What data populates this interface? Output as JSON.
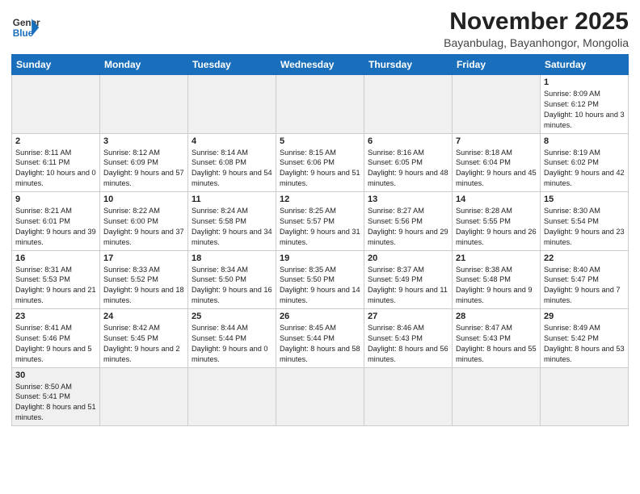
{
  "logo": {
    "general": "General",
    "blue": "Blue"
  },
  "title": "November 2025",
  "subtitle": "Bayanbulag, Bayanhongor, Mongolia",
  "days_header": [
    "Sunday",
    "Monday",
    "Tuesday",
    "Wednesday",
    "Thursday",
    "Friday",
    "Saturday"
  ],
  "weeks": [
    [
      {
        "day": "",
        "info": "",
        "empty": true
      },
      {
        "day": "",
        "info": "",
        "empty": true
      },
      {
        "day": "",
        "info": "",
        "empty": true
      },
      {
        "day": "",
        "info": "",
        "empty": true
      },
      {
        "day": "",
        "info": "",
        "empty": true
      },
      {
        "day": "",
        "info": "",
        "empty": true
      },
      {
        "day": "1",
        "info": "Sunrise: 8:09 AM\nSunset: 6:12 PM\nDaylight: 10 hours\nand 3 minutes."
      }
    ],
    [
      {
        "day": "2",
        "info": "Sunrise: 8:11 AM\nSunset: 6:11 PM\nDaylight: 10 hours\nand 0 minutes."
      },
      {
        "day": "3",
        "info": "Sunrise: 8:12 AM\nSunset: 6:09 PM\nDaylight: 9 hours\nand 57 minutes."
      },
      {
        "day": "4",
        "info": "Sunrise: 8:14 AM\nSunset: 6:08 PM\nDaylight: 9 hours\nand 54 minutes."
      },
      {
        "day": "5",
        "info": "Sunrise: 8:15 AM\nSunset: 6:06 PM\nDaylight: 9 hours\nand 51 minutes."
      },
      {
        "day": "6",
        "info": "Sunrise: 8:16 AM\nSunset: 6:05 PM\nDaylight: 9 hours\nand 48 minutes."
      },
      {
        "day": "7",
        "info": "Sunrise: 8:18 AM\nSunset: 6:04 PM\nDaylight: 9 hours\nand 45 minutes."
      },
      {
        "day": "8",
        "info": "Sunrise: 8:19 AM\nSunset: 6:02 PM\nDaylight: 9 hours\nand 42 minutes."
      }
    ],
    [
      {
        "day": "9",
        "info": "Sunrise: 8:21 AM\nSunset: 6:01 PM\nDaylight: 9 hours\nand 39 minutes."
      },
      {
        "day": "10",
        "info": "Sunrise: 8:22 AM\nSunset: 6:00 PM\nDaylight: 9 hours\nand 37 minutes."
      },
      {
        "day": "11",
        "info": "Sunrise: 8:24 AM\nSunset: 5:58 PM\nDaylight: 9 hours\nand 34 minutes."
      },
      {
        "day": "12",
        "info": "Sunrise: 8:25 AM\nSunset: 5:57 PM\nDaylight: 9 hours\nand 31 minutes."
      },
      {
        "day": "13",
        "info": "Sunrise: 8:27 AM\nSunset: 5:56 PM\nDaylight: 9 hours\nand 29 minutes."
      },
      {
        "day": "14",
        "info": "Sunrise: 8:28 AM\nSunset: 5:55 PM\nDaylight: 9 hours\nand 26 minutes."
      },
      {
        "day": "15",
        "info": "Sunrise: 8:30 AM\nSunset: 5:54 PM\nDaylight: 9 hours\nand 23 minutes."
      }
    ],
    [
      {
        "day": "16",
        "info": "Sunrise: 8:31 AM\nSunset: 5:53 PM\nDaylight: 9 hours\nand 21 minutes."
      },
      {
        "day": "17",
        "info": "Sunrise: 8:33 AM\nSunset: 5:52 PM\nDaylight: 9 hours\nand 18 minutes."
      },
      {
        "day": "18",
        "info": "Sunrise: 8:34 AM\nSunset: 5:50 PM\nDaylight: 9 hours\nand 16 minutes."
      },
      {
        "day": "19",
        "info": "Sunrise: 8:35 AM\nSunset: 5:50 PM\nDaylight: 9 hours\nand 14 minutes."
      },
      {
        "day": "20",
        "info": "Sunrise: 8:37 AM\nSunset: 5:49 PM\nDaylight: 9 hours\nand 11 minutes."
      },
      {
        "day": "21",
        "info": "Sunrise: 8:38 AM\nSunset: 5:48 PM\nDaylight: 9 hours\nand 9 minutes."
      },
      {
        "day": "22",
        "info": "Sunrise: 8:40 AM\nSunset: 5:47 PM\nDaylight: 9 hours\nand 7 minutes."
      }
    ],
    [
      {
        "day": "23",
        "info": "Sunrise: 8:41 AM\nSunset: 5:46 PM\nDaylight: 9 hours\nand 5 minutes."
      },
      {
        "day": "24",
        "info": "Sunrise: 8:42 AM\nSunset: 5:45 PM\nDaylight: 9 hours\nand 2 minutes."
      },
      {
        "day": "25",
        "info": "Sunrise: 8:44 AM\nSunset: 5:44 PM\nDaylight: 9 hours\nand 0 minutes."
      },
      {
        "day": "26",
        "info": "Sunrise: 8:45 AM\nSunset: 5:44 PM\nDaylight: 8 hours\nand 58 minutes."
      },
      {
        "day": "27",
        "info": "Sunrise: 8:46 AM\nSunset: 5:43 PM\nDaylight: 8 hours\nand 56 minutes."
      },
      {
        "day": "28",
        "info": "Sunrise: 8:47 AM\nSunset: 5:43 PM\nDaylight: 8 hours\nand 55 minutes."
      },
      {
        "day": "29",
        "info": "Sunrise: 8:49 AM\nSunset: 5:42 PM\nDaylight: 8 hours\nand 53 minutes."
      }
    ],
    [
      {
        "day": "30",
        "info": "Sunrise: 8:50 AM\nSunset: 5:41 PM\nDaylight: 8 hours\nand 51 minutes.",
        "last": true
      },
      {
        "day": "",
        "info": "",
        "empty": true
      },
      {
        "day": "",
        "info": "",
        "empty": true
      },
      {
        "day": "",
        "info": "",
        "empty": true
      },
      {
        "day": "",
        "info": "",
        "empty": true
      },
      {
        "day": "",
        "info": "",
        "empty": true
      },
      {
        "day": "",
        "info": "",
        "empty": true
      }
    ]
  ]
}
